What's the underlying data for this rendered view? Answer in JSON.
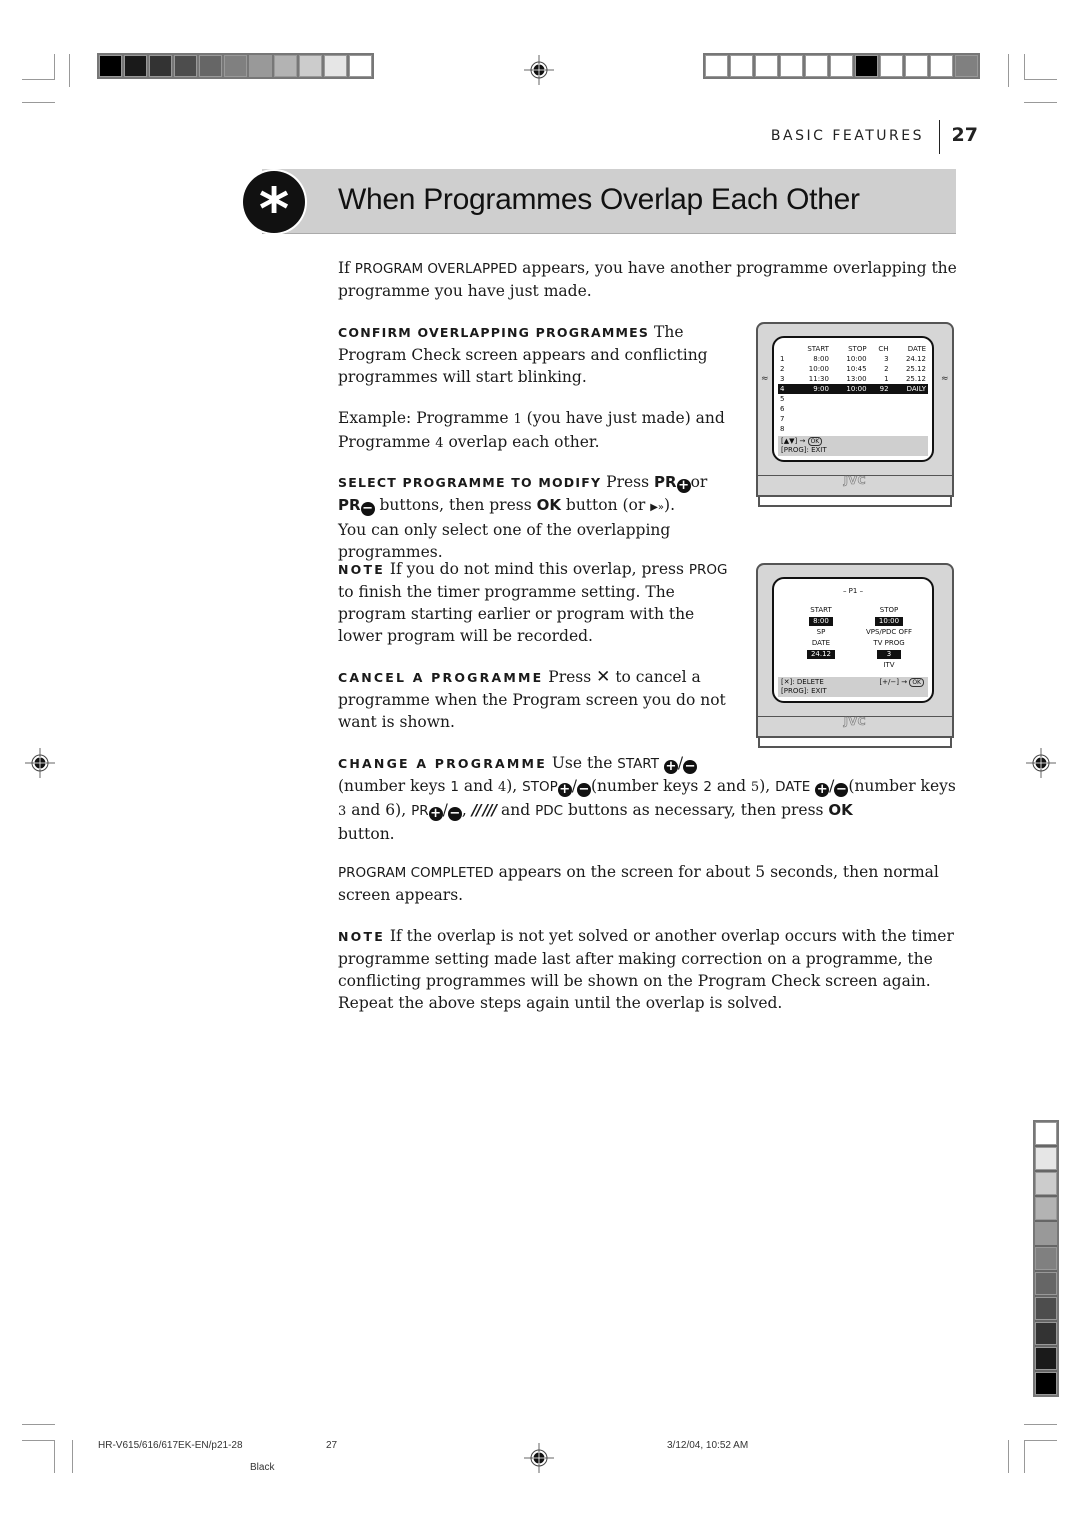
{
  "colors": {
    "title_band": "#cfcfcf",
    "ink": "#111111",
    "tv_body": "#d6d6d6",
    "tv_footer_bar": "#cfcfcf"
  },
  "print_marks": {
    "top_strip_left": [
      "#000000",
      "#1a1a1a",
      "#333333",
      "#4d4d4d",
      "#666666",
      "#808080",
      "#999999",
      "#b3b3b3",
      "#cccccc",
      "#e6e6e6",
      "#ffffff"
    ],
    "top_strip_right": [
      "#ffffff",
      "#ffffff",
      "#ffffff",
      "#ffffff",
      "#ffffff",
      "#ffffff",
      "#000000",
      "#ffffff",
      "#ffffff",
      "#ffffff",
      "#808080"
    ],
    "side_strip": [
      "#ffffff",
      "#e6e6e6",
      "#cccccc",
      "#b3b3b3",
      "#999999",
      "#808080",
      "#666666",
      "#4d4d4d",
      "#333333",
      "#1a1a1a",
      "#000000"
    ]
  },
  "running_head": {
    "section": "BASIC FEATURES",
    "page_number": "27"
  },
  "title": {
    "icon": "asterisk-icon",
    "icon_glyph": "*",
    "text": "When Programmes Overlap Each Other"
  },
  "intro": {
    "pre": "If ",
    "keyword": "PROGRAM OVERLAPPED",
    "post": " appears, you have another programme overlapping the programme you have just made."
  },
  "confirm": {
    "lead": "CONFIRM OVERLAPPING PROGRAMMES",
    "text": " The Program Check screen appears and conflicting programmes will start blinking."
  },
  "example": {
    "text_a": "Example: Programme ",
    "num1": "1",
    "text_b": " (you have just made) and Programme ",
    "num2": "4",
    "text_c": " overlap each other."
  },
  "select": {
    "lead": "SELECT PROGRAMME TO MODIFY",
    "press": " Press ",
    "pr": "PR",
    "plus": "+",
    "or": "or",
    "minus": "−",
    "mid": " buttons, then press ",
    "ok": "OK",
    "after": " button (or ",
    "play_glyph": "▶»",
    "close": ").",
    "line2": "You can only select one of the overlapping programmes."
  },
  "note1": {
    "lead": "NOTE",
    "text_a": " If you do not mind this overlap, press ",
    "keyword": "PROG",
    "text_b": " to finish the timer programme setting. The program starting earlier or program with the lower program will be recorded."
  },
  "cancel": {
    "lead": "CANCEL A PROGRAMME",
    "text_a": " Press ",
    "x_glyph": "✕",
    "text_b": " to cancel a programme when the Program screen you do not want is shown."
  },
  "change": {
    "lead": "CHANGE A PROGRAMME",
    "t1": " Use the ",
    "start": "START",
    "t2": "(number keys ",
    "k1": "1",
    "t3": " and ",
    "k4": "4",
    "t4": "), ",
    "stop": "STOP",
    "t5": "(number keys ",
    "k2": "2",
    "k5": "5",
    "date": "DATE",
    "t6": "(number keys ",
    "k3": "3",
    "k6": "6",
    "pr": "PR",
    "slashes": "// ///",
    "t7": " and ",
    "pdc": "PDC",
    "t8": " buttons as necessary, then press ",
    "ok": "OK",
    "t9": " button.",
    "plus": "+",
    "minus": "−",
    "slash": "/"
  },
  "completed": {
    "keyword": "PROGRAM COMPLETED",
    "text": " appears on the screen for about 5 seconds, then normal screen appears."
  },
  "note2": {
    "lead": "NOTE",
    "text": " If the overlap is not yet solved or another overlap occurs with the timer programme setting made last after making correction on a programme, the conflicting programmes will be shown on the Program Check screen again. Repeat the above steps again until the overlap is solved."
  },
  "tv_program_check": {
    "headers": [
      "",
      "START",
      "STOP",
      "CH",
      "DATE"
    ],
    "rows": [
      {
        "idx": "1",
        "start": "8:00",
        "stop": "10:00",
        "ch": "3",
        "date": "24.12",
        "selected": false
      },
      {
        "idx": "2",
        "start": "10:00",
        "stop": "10:45",
        "ch": "2",
        "date": "25.12",
        "selected": false
      },
      {
        "idx": "3",
        "start": "11:30",
        "stop": "13:00",
        "ch": "1",
        "date": "25.12",
        "selected": false
      },
      {
        "idx": "4",
        "start": "9:00",
        "stop": "10:00",
        "ch": "92",
        "date": "DAILY",
        "selected": true
      },
      {
        "idx": "5",
        "start": "",
        "stop": "",
        "ch": "",
        "date": "",
        "selected": false
      },
      {
        "idx": "6",
        "start": "",
        "stop": "",
        "ch": "",
        "date": "",
        "selected": false
      },
      {
        "idx": "7",
        "start": "",
        "stop": "",
        "ch": "",
        "date": "",
        "selected": false
      },
      {
        "idx": "8",
        "start": "",
        "stop": "",
        "ch": "",
        "date": "",
        "selected": false
      }
    ],
    "footer_line1": "[▲▼] →",
    "footer_ok": "OK",
    "footer_line2": "[PROG]: EXIT",
    "blink_glyph": "≈",
    "logo": "JVC"
  },
  "tv_program_edit": {
    "title": "– P1 –",
    "start_label": "START",
    "start_value": "8:00",
    "stop_label": "STOP",
    "stop_value": "10:00",
    "speed": "SP",
    "vps_pdc": "VPS/PDC OFF",
    "date_label": "DATE",
    "date_value": "24.12",
    "tvprog_label": "TV PROG",
    "tvprog_value": "3",
    "station": "ITV",
    "footer_delete": "[✕]: DELETE",
    "footer_adjust": "[+/−] →",
    "footer_ok": "OK",
    "footer_exit": "[PROG]: EXIT",
    "logo": "JVC"
  },
  "slug": {
    "file": "HR-V615/616/617EK-EN/p21-28",
    "page": "27",
    "datetime": "3/12/04, 10:52 AM",
    "plate": "Black"
  }
}
